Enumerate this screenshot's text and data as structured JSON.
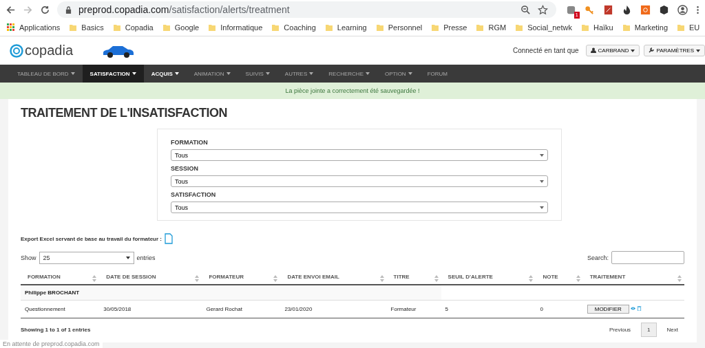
{
  "browser": {
    "url_host": "preprod.copadia.com",
    "url_path": "/satisfaction/alerts/treatment",
    "extension_badge": "1",
    "bookmarks": [
      {
        "label": "Applications",
        "kind": "apps"
      },
      {
        "label": "Basics",
        "kind": "folder"
      },
      {
        "label": "Copadia",
        "kind": "folder"
      },
      {
        "label": "Google",
        "kind": "folder"
      },
      {
        "label": "Informatique",
        "kind": "folder"
      },
      {
        "label": "Coaching",
        "kind": "folder"
      },
      {
        "label": "Learning",
        "kind": "folder"
      },
      {
        "label": "Personnel",
        "kind": "folder"
      },
      {
        "label": "Presse",
        "kind": "folder"
      },
      {
        "label": "RGM",
        "kind": "folder"
      },
      {
        "label": "Social_netwk",
        "kind": "folder"
      },
      {
        "label": "Haïku",
        "kind": "folder"
      },
      {
        "label": "Marketing",
        "kind": "folder"
      },
      {
        "label": "EU",
        "kind": "folder"
      }
    ]
  },
  "header": {
    "logo": "copadia",
    "connected_label": "Connecté en tant que",
    "user_button": "CARBRAND",
    "settings_button": "PARAMÈTRES"
  },
  "nav": [
    {
      "label": "TABLEAU DE BORD",
      "selected": false,
      "emphasized": false,
      "caret": true
    },
    {
      "label": "SATISFACTION",
      "selected": true,
      "emphasized": true,
      "caret": true
    },
    {
      "label": "ACQUIS",
      "selected": false,
      "emphasized": true,
      "caret": true
    },
    {
      "label": "ANIMATION",
      "selected": false,
      "emphasized": false,
      "caret": true
    },
    {
      "label": "SUIVIS",
      "selected": false,
      "emphasized": false,
      "caret": true
    },
    {
      "label": "AUTRES",
      "selected": false,
      "emphasized": false,
      "caret": true
    },
    {
      "label": "RECHERCHE",
      "selected": false,
      "emphasized": false,
      "caret": true
    },
    {
      "label": "OPTION",
      "selected": false,
      "emphasized": false,
      "caret": true
    },
    {
      "label": "FORUM",
      "selected": false,
      "emphasized": false,
      "caret": false
    }
  ],
  "alert": "La pièce jointe a correctement été sauvegardée !",
  "page_title": "TRAITEMENT DE L'INSATISFACTION",
  "filters": [
    {
      "label": "FORMATION",
      "value": "Tous"
    },
    {
      "label": "SESSION",
      "value": "Tous"
    },
    {
      "label": "SATISFACTION",
      "value": "Tous"
    }
  ],
  "export_label": "Export Excel servant de base au travail du formateur :",
  "table": {
    "show_label": "Show",
    "page_size": "25",
    "entries_label": "entries",
    "search_label": "Search:",
    "columns": [
      "FORMATION",
      "DATE DE SESSION",
      "FORMATEUR",
      "DATE ENVOI EMAIL",
      "TITRE",
      "SEUIL D'ALERTE",
      "NOTE",
      "TRAITEMENT"
    ],
    "groups": [
      {
        "name": "Philippe BROCHANT",
        "rows": [
          {
            "cells": [
              "Questionnement",
              "30/05/2018",
              "Gerard Rochat",
              "23/01/2020",
              "Formateur",
              "5",
              "0"
            ],
            "action": "MODIFIER"
          }
        ]
      }
    ],
    "info": "Showing 1 to 1 of 1 entries",
    "pagination": [
      {
        "label": "Previous",
        "selected": false
      },
      {
        "label": "1",
        "selected": true
      },
      {
        "label": "Next",
        "selected": false
      }
    ]
  },
  "status_bar": "En attente de preprod.copadia.com"
}
